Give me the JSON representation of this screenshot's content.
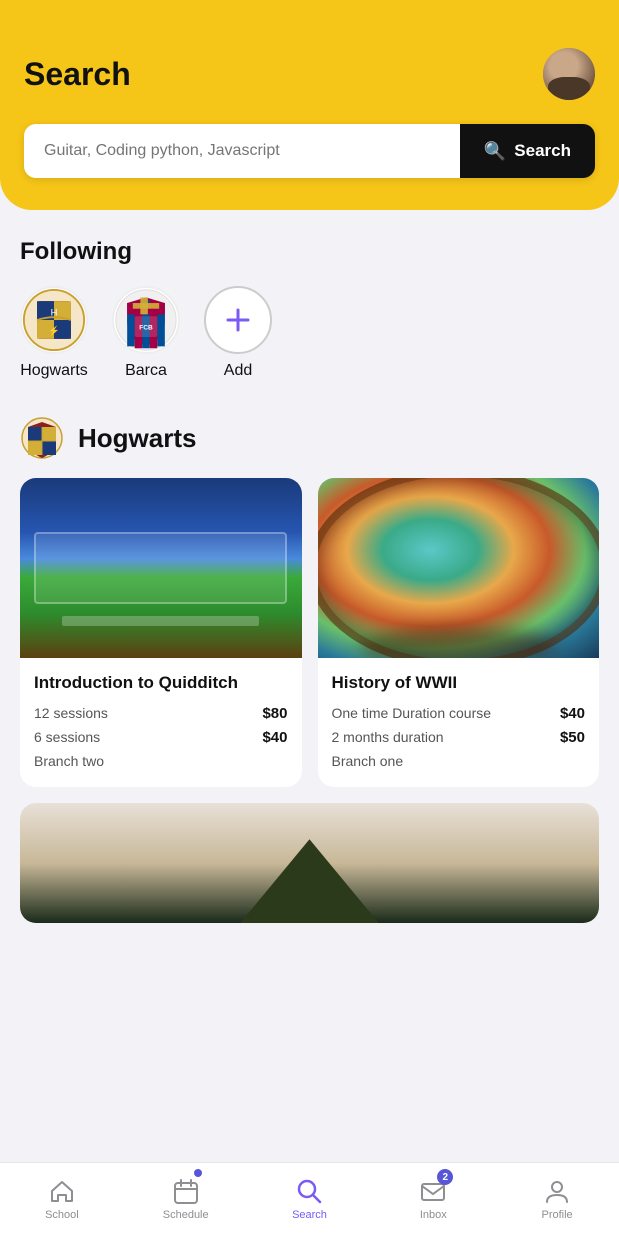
{
  "header": {
    "title": "Search",
    "search_placeholder": "Guitar, Coding python, Javascript",
    "search_button_label": "Search"
  },
  "following": {
    "section_title": "Following",
    "items": [
      {
        "id": "hogwarts",
        "label": "Hogwarts",
        "type": "hogwarts"
      },
      {
        "id": "barca",
        "label": "Barca",
        "type": "barca"
      },
      {
        "id": "add",
        "label": "Add",
        "type": "add"
      }
    ]
  },
  "school_section": {
    "school_name": "Hogwarts",
    "cards": [
      {
        "id": "quidditch",
        "title": "Introduction to Quidditch",
        "image": "stadium",
        "details": [
          {
            "label": "12 sessions",
            "price": "$80"
          },
          {
            "label": "6 sessions",
            "price": "$40"
          }
        ],
        "branch": "Branch two"
      },
      {
        "id": "wwii",
        "title": "History of WWII",
        "image": "globe",
        "details": [
          {
            "label": "One time Duration course",
            "price": "$40"
          },
          {
            "label": "2 months duration",
            "price": "$50"
          }
        ],
        "branch": "Branch one"
      }
    ]
  },
  "bottom_nav": {
    "items": [
      {
        "id": "school",
        "label": "School",
        "icon": "house",
        "active": false
      },
      {
        "id": "schedule",
        "label": "Schedule",
        "icon": "calendar",
        "active": false,
        "dot": true
      },
      {
        "id": "search",
        "label": "Search",
        "icon": "search",
        "active": true
      },
      {
        "id": "inbox",
        "label": "Inbox",
        "icon": "envelope",
        "active": false,
        "badge": "2"
      },
      {
        "id": "profile",
        "label": "Profile",
        "icon": "person",
        "active": false
      }
    ]
  },
  "colors": {
    "accent": "#f5c518",
    "active": "#7b5af5",
    "black": "#111",
    "gray": "#8e8e93"
  }
}
